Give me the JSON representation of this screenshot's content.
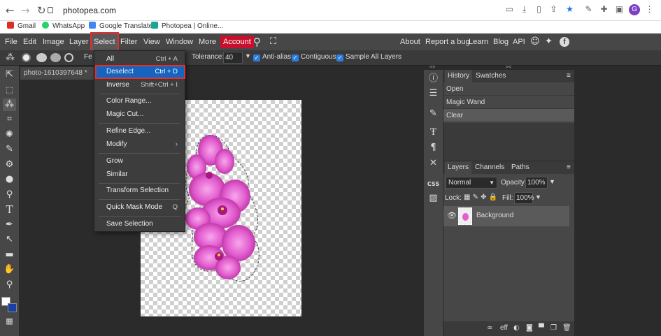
{
  "browser": {
    "url": "photopea.com",
    "bookmarks": [
      {
        "label": "Gmail",
        "color": "#d93025"
      },
      {
        "label": "WhatsApp",
        "color": "#25d366"
      },
      {
        "label": "Google Translate",
        "color": "#4285f4"
      },
      {
        "label": "Photopea | Online...",
        "color": "#18a497"
      }
    ],
    "profile_initial": "G"
  },
  "menu": {
    "items": [
      "File",
      "Edit",
      "Image",
      "Layer",
      "Select",
      "Filter",
      "View",
      "Window",
      "More"
    ],
    "account": "Account",
    "right_links": [
      "About",
      "Report a bug",
      "Learn",
      "Blog",
      "API"
    ]
  },
  "options": {
    "feather_label": "Fe",
    "tolerance_label": "Tolerance:",
    "tolerance_value": "40",
    "antialias": "Anti-alias",
    "contiguous": "Contiguous",
    "sample_all": "Sample All Layers"
  },
  "document": {
    "tab_label": "photo-1610397648 *"
  },
  "select_menu": [
    {
      "label": "All",
      "shortcut": "Ctrl + A"
    },
    {
      "label": "Deselect",
      "shortcut": "Ctrl + D"
    },
    {
      "label": "Inverse",
      "shortcut": "Shift+Ctrl + I"
    },
    {
      "label": "Color Range...",
      "shortcut": ""
    },
    {
      "label": "Magic Cut...",
      "shortcut": ""
    },
    {
      "label": "Refine Edge...",
      "shortcut": ""
    },
    {
      "label": "Modify",
      "shortcut": "›"
    },
    {
      "label": "Grow",
      "shortcut": ""
    },
    {
      "label": "Similar",
      "shortcut": ""
    },
    {
      "label": "Transform Selection",
      "shortcut": ""
    },
    {
      "label": "Quick Mask Mode",
      "shortcut": "Q"
    },
    {
      "label": "Save Selection",
      "shortcut": ""
    }
  ],
  "history_panel": {
    "tabs": [
      "History",
      "Swatches"
    ],
    "entries": [
      "Open",
      "Magic Wand",
      "Clear"
    ]
  },
  "layers_panel": {
    "tabs": [
      "Layers",
      "Channels",
      "Paths"
    ],
    "blend_mode": "Normal",
    "opacity_label": "Opacity:",
    "opacity_value": "100%",
    "lock_label": "Lock:",
    "fill_label": "Fill:",
    "fill_value": "100%",
    "layer_name": "Background",
    "footer_text": "eff"
  },
  "colors": {
    "accent_red": "#e03030",
    "highlight_blue": "#1565c0",
    "flower_pink": "#e35fd0",
    "bg_color": "#1a3fa3"
  },
  "side_panel_css_label": "CSS"
}
